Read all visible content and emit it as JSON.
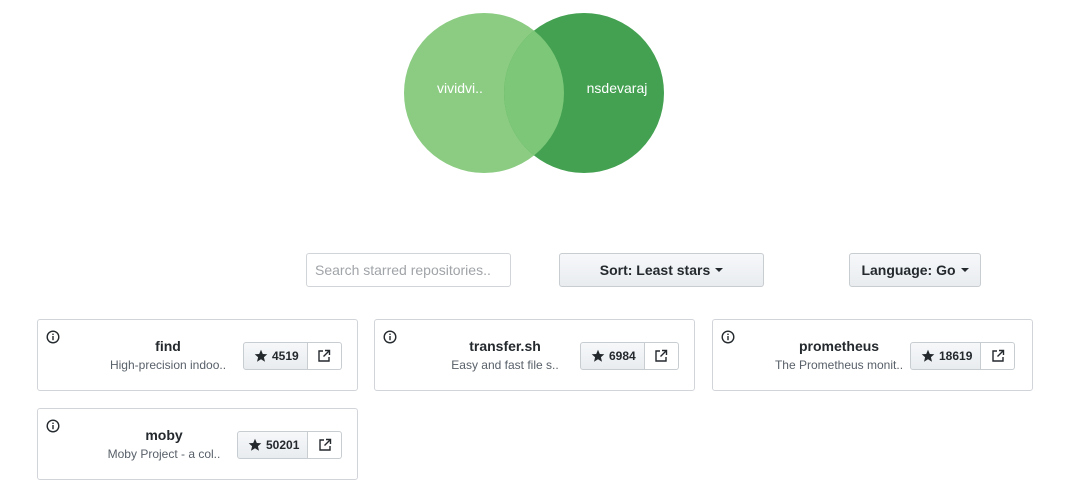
{
  "venn": {
    "left_label": "vividvi..",
    "right_label": "nsdevaraj",
    "left_color": "#8bcc82",
    "right_color": "#43a151",
    "overlap_color": "#7dc778"
  },
  "controls": {
    "search_placeholder": "Search starred repositories..",
    "search_value": "",
    "sort_label": "Sort: Least stars",
    "language_label": "Language: Go"
  },
  "repos": [
    {
      "name": "find",
      "description": "High-precision indoo..",
      "stars": "4519"
    },
    {
      "name": "transfer.sh",
      "description": "Easy and fast file s..",
      "stars": "6984"
    },
    {
      "name": "prometheus",
      "description": "The Prometheus monit..",
      "stars": "18619"
    },
    {
      "name": "moby",
      "description": "Moby Project - a col..",
      "stars": "50201"
    }
  ],
  "icons": {
    "info": "info-icon",
    "star": "star-icon",
    "external": "external-link-icon"
  }
}
